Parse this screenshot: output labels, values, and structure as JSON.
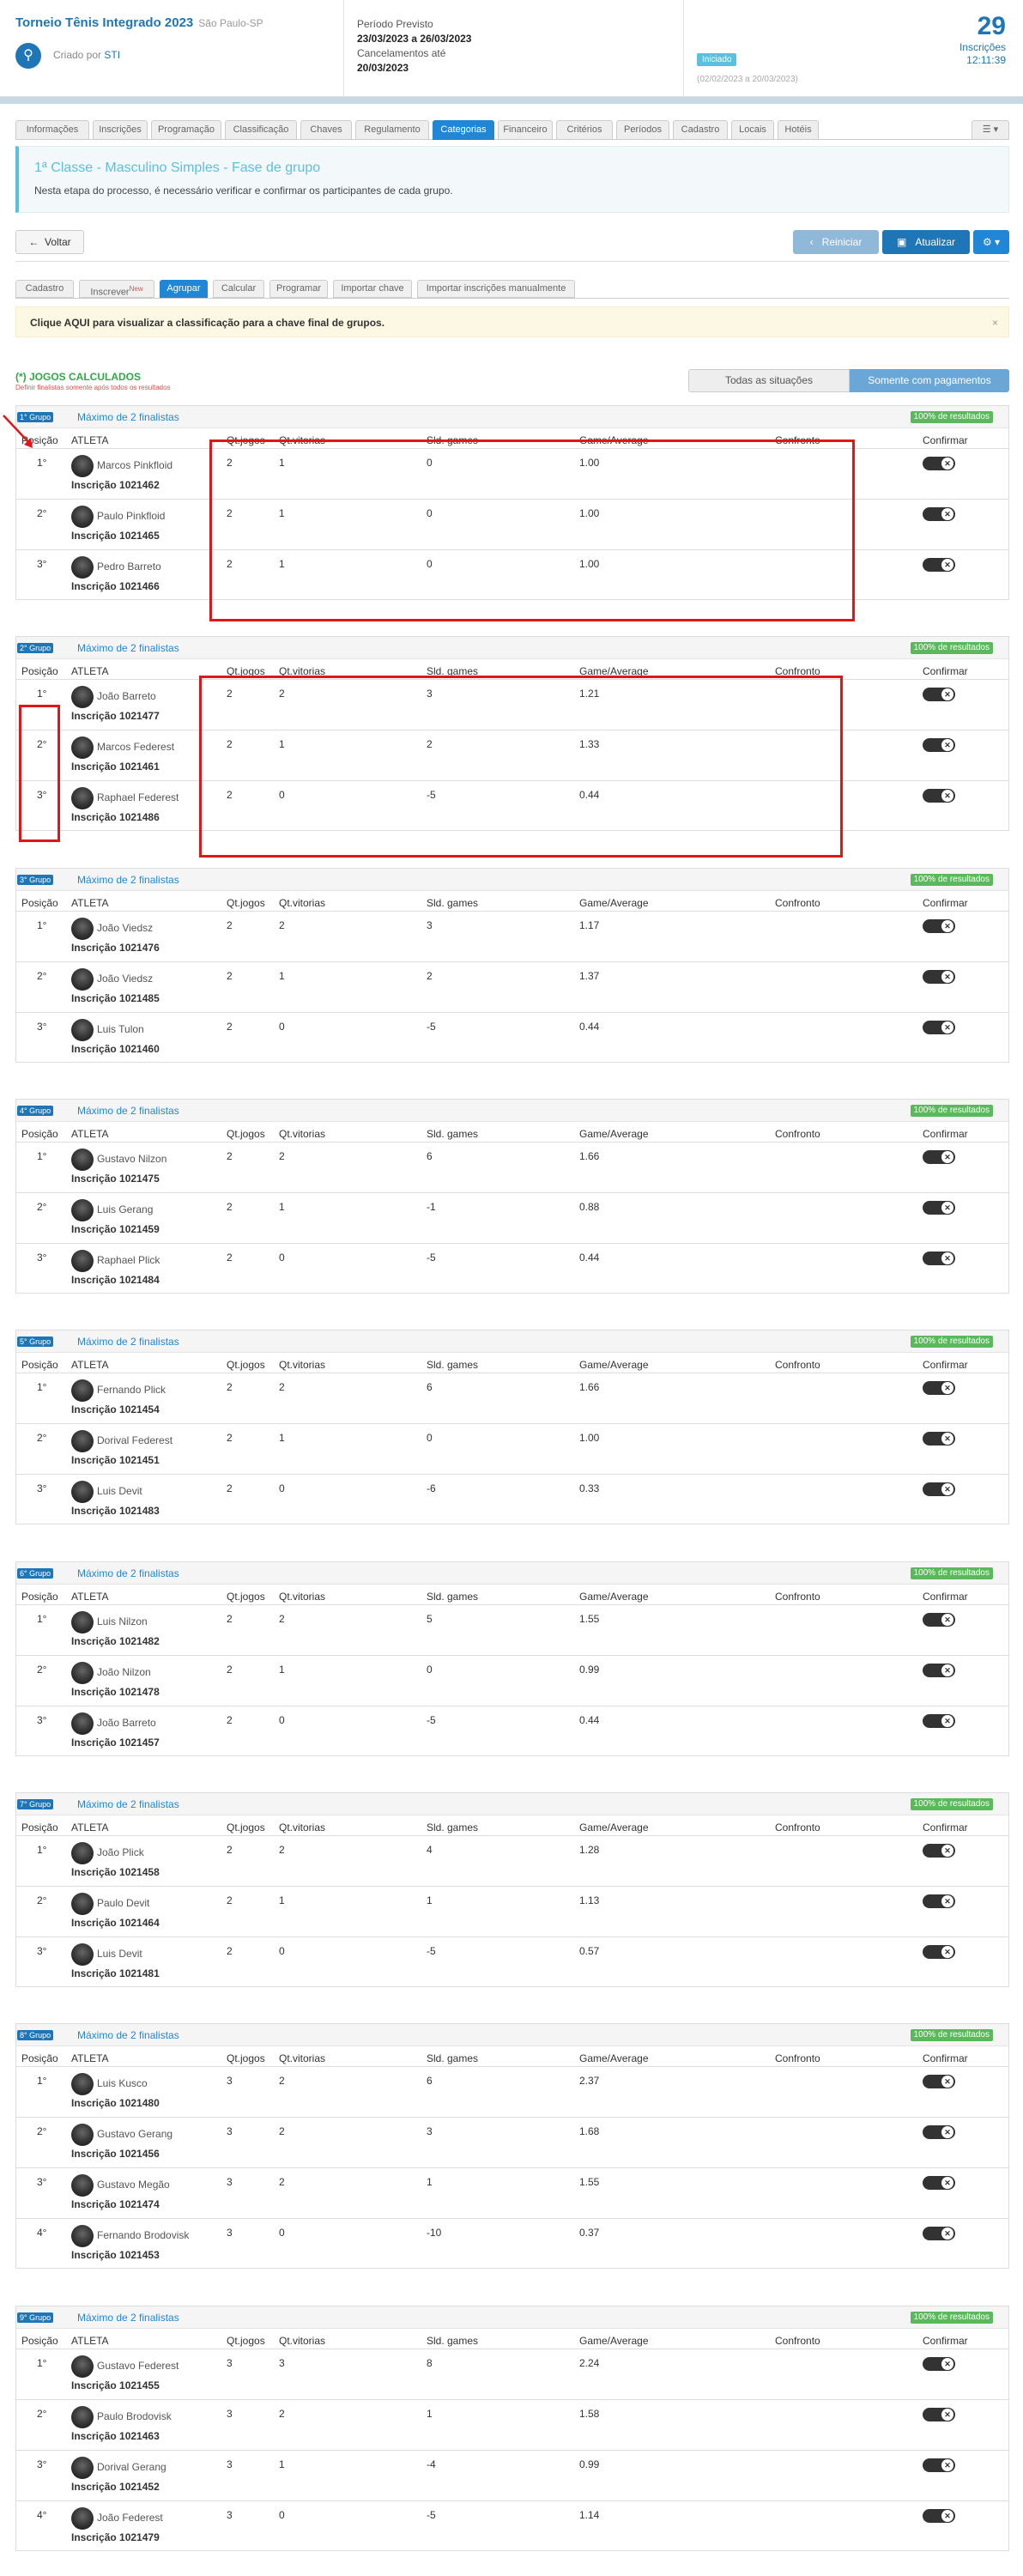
{
  "header": {
    "title": "Torneio Tênis Integrado 2023",
    "location": "São Paulo-SP",
    "created_by_label": "Criado por",
    "created_by": "STI",
    "period_label": "Período Previsto",
    "period": "23/03/2023 a 26/03/2023",
    "cancel_label": "Cancelamentos até",
    "cancel_date": "20/03/2023",
    "status": "Iniciado",
    "status_dates": "(02/02/2023 a 20/03/2023)",
    "inscriptions_count": "29",
    "inscriptions_label": "Inscrições",
    "time": "12:11:39"
  },
  "main_tabs": [
    "Informações",
    "Inscrições",
    "Programação",
    "Classificação",
    "Chaves",
    "Regulamento",
    "Categorias",
    "Financeiro",
    "Critérios",
    "Períodos",
    "Cadastro",
    "Locais",
    "Hotéis"
  ],
  "main_tabs_menu": "☰ ▾",
  "info": {
    "title": "1ª Classe - Masculino Simples - Fase de grupo",
    "text": "Nesta etapa do processo, é necessário verificar e confirmar os participantes de cada grupo."
  },
  "toolbar": {
    "back": "Voltar",
    "reiniciar": "Reiniciar",
    "atualizar": "Atualizar",
    "gear": "⚙ ▾"
  },
  "sub_tabs": [
    "Cadastro",
    "Inscrever",
    "Agrupar",
    "Calcular",
    "Programar",
    "Importar chave",
    "Importar inscrições manualmente"
  ],
  "sub_tab_new": "New",
  "notice": {
    "text": "Clique AQUI para visualizar a classificação para a chave final de grupos.",
    "close": "×"
  },
  "calc": {
    "title": "(*) JOGOS CALCULADOS",
    "note": "Definir finalistas somente após todos os resultados"
  },
  "filters": {
    "all": "Todas as situações",
    "paid": "Somente com pagamentos"
  },
  "table_headers": {
    "pos": "Posição",
    "athlete": "ATLETA",
    "games": "Qt.jogos",
    "wins": "Qt.vitorias",
    "saldo": "Sld. games",
    "avg": "Game/Average",
    "confronto": "Confronto",
    "confirm": "Confirmar"
  },
  "groups": [
    {
      "label": "1° Grupo",
      "max": "Máximo de 2 finalistas",
      "badge": "100% de resultados",
      "rows": [
        {
          "pos": "1°",
          "name": "Marcos Pinkfloid",
          "ins": "Inscrição 1021462",
          "games": "2",
          "wins": "1",
          "saldo": "0",
          "avg": "1.00"
        },
        {
          "pos": "2°",
          "name": "Paulo Pinkfloid",
          "ins": "Inscrição 1021465",
          "games": "2",
          "wins": "1",
          "saldo": "0",
          "avg": "1.00"
        },
        {
          "pos": "3°",
          "name": "Pedro Barreto",
          "ins": "Inscrição 1021466",
          "games": "2",
          "wins": "1",
          "saldo": "0",
          "avg": "1.00"
        }
      ]
    },
    {
      "label": "2° Grupo",
      "max": "Máximo de 2 finalistas",
      "badge": "100% de resultados",
      "rows": [
        {
          "pos": "1°",
          "name": "João Barreto",
          "ins": "Inscrição 1021477",
          "games": "2",
          "wins": "2",
          "saldo": "3",
          "avg": "1.21"
        },
        {
          "pos": "2°",
          "name": "Marcos Federest",
          "ins": "Inscrição 1021461",
          "games": "2",
          "wins": "1",
          "saldo": "2",
          "avg": "1.33"
        },
        {
          "pos": "3°",
          "name": "Raphael Federest",
          "ins": "Inscrição 1021486",
          "games": "2",
          "wins": "0",
          "saldo": "-5",
          "avg": "0.44"
        }
      ]
    },
    {
      "label": "3° Grupo",
      "max": "Máximo de 2 finalistas",
      "badge": "100% de resultados",
      "rows": [
        {
          "pos": "1°",
          "name": "João Viedsz",
          "ins": "Inscrição 1021476",
          "games": "2",
          "wins": "2",
          "saldo": "3",
          "avg": "1.17"
        },
        {
          "pos": "2°",
          "name": "João Viedsz",
          "ins": "Inscrição 1021485",
          "games": "2",
          "wins": "1",
          "saldo": "2",
          "avg": "1.37"
        },
        {
          "pos": "3°",
          "name": "Luis Tulon",
          "ins": "Inscrição 1021460",
          "games": "2",
          "wins": "0",
          "saldo": "-5",
          "avg": "0.44"
        }
      ]
    },
    {
      "label": "4° Grupo",
      "max": "Máximo de 2 finalistas",
      "badge": "100% de resultados",
      "rows": [
        {
          "pos": "1°",
          "name": "Gustavo Nilzon",
          "ins": "Inscrição 1021475",
          "games": "2",
          "wins": "2",
          "saldo": "6",
          "avg": "1.66"
        },
        {
          "pos": "2°",
          "name": "Luis Gerang",
          "ins": "Inscrição 1021459",
          "games": "2",
          "wins": "1",
          "saldo": "-1",
          "avg": "0.88"
        },
        {
          "pos": "3°",
          "name": "Raphael Plick",
          "ins": "Inscrição 1021484",
          "games": "2",
          "wins": "0",
          "saldo": "-5",
          "avg": "0.44"
        }
      ]
    },
    {
      "label": "5° Grupo",
      "max": "Máximo de 2 finalistas",
      "badge": "100% de resultados",
      "rows": [
        {
          "pos": "1°",
          "name": "Fernando Plick",
          "ins": "Inscrição 1021454",
          "games": "2",
          "wins": "2",
          "saldo": "6",
          "avg": "1.66"
        },
        {
          "pos": "2°",
          "name": "Dorival Federest",
          "ins": "Inscrição 1021451",
          "games": "2",
          "wins": "1",
          "saldo": "0",
          "avg": "1.00"
        },
        {
          "pos": "3°",
          "name": "Luis Devit",
          "ins": "Inscrição 1021483",
          "games": "2",
          "wins": "0",
          "saldo": "-6",
          "avg": "0.33"
        }
      ]
    },
    {
      "label": "6° Grupo",
      "max": "Máximo de 2 finalistas",
      "badge": "100% de resultados",
      "rows": [
        {
          "pos": "1°",
          "name": "Luis Nilzon",
          "ins": "Inscrição 1021482",
          "games": "2",
          "wins": "2",
          "saldo": "5",
          "avg": "1.55"
        },
        {
          "pos": "2°",
          "name": "João Nilzon",
          "ins": "Inscrição 1021478",
          "games": "2",
          "wins": "1",
          "saldo": "0",
          "avg": "0.99"
        },
        {
          "pos": "3°",
          "name": "João Barreto",
          "ins": "Inscrição 1021457",
          "games": "2",
          "wins": "0",
          "saldo": "-5",
          "avg": "0.44"
        }
      ]
    },
    {
      "label": "7° Grupo",
      "max": "Máximo de 2 finalistas",
      "badge": "100% de resultados",
      "rows": [
        {
          "pos": "1°",
          "name": "João Plick",
          "ins": "Inscrição 1021458",
          "games": "2",
          "wins": "2",
          "saldo": "4",
          "avg": "1.28"
        },
        {
          "pos": "2°",
          "name": "Paulo Devit",
          "ins": "Inscrição 1021464",
          "games": "2",
          "wins": "1",
          "saldo": "1",
          "avg": "1.13"
        },
        {
          "pos": "3°",
          "name": "Luis Devit",
          "ins": "Inscrição 1021481",
          "games": "2",
          "wins": "0",
          "saldo": "-5",
          "avg": "0.57"
        }
      ]
    },
    {
      "label": "8° Grupo",
      "max": "Máximo de 2 finalistas",
      "badge": "100% de resultados",
      "rows": [
        {
          "pos": "1°",
          "name": "Luis Kusco",
          "ins": "Inscrição 1021480",
          "games": "3",
          "wins": "2",
          "saldo": "6",
          "avg": "2.37"
        },
        {
          "pos": "2°",
          "name": "Gustavo Gerang",
          "ins": "Inscrição 1021456",
          "games": "3",
          "wins": "2",
          "saldo": "3",
          "avg": "1.68"
        },
        {
          "pos": "3°",
          "name": "Gustavo Megão",
          "ins": "Inscrição 1021474",
          "games": "3",
          "wins": "2",
          "saldo": "1",
          "avg": "1.55"
        },
        {
          "pos": "4°",
          "name": "Fernando Brodovisk",
          "ins": "Inscrição 1021453",
          "games": "3",
          "wins": "0",
          "saldo": "-10",
          "avg": "0.37"
        }
      ]
    },
    {
      "label": "9° Grupo",
      "max": "Máximo de 2 finalistas",
      "badge": "100% de resultados",
      "rows": [
        {
          "pos": "1°",
          "name": "Gustavo Federest",
          "ins": "Inscrição 1021455",
          "games": "3",
          "wins": "3",
          "saldo": "8",
          "avg": "2.24"
        },
        {
          "pos": "2°",
          "name": "Paulo Brodovisk",
          "ins": "Inscrição 1021463",
          "games": "3",
          "wins": "2",
          "saldo": "1",
          "avg": "1.58"
        },
        {
          "pos": "3°",
          "name": "Dorival Gerang",
          "ins": "Inscrição 1021452",
          "games": "3",
          "wins": "1",
          "saldo": "-4",
          "avg": "0.99"
        },
        {
          "pos": "4°",
          "name": "João Federest",
          "ins": "Inscrição 1021479",
          "games": "3",
          "wins": "0",
          "saldo": "-5",
          "avg": "1.14"
        }
      ]
    }
  ],
  "colors": {
    "primary": "#1f76b6",
    "accent": "#1f87d6",
    "info": "#5bc0de",
    "success": "#5cb85c",
    "annotation": "#e0161b"
  }
}
